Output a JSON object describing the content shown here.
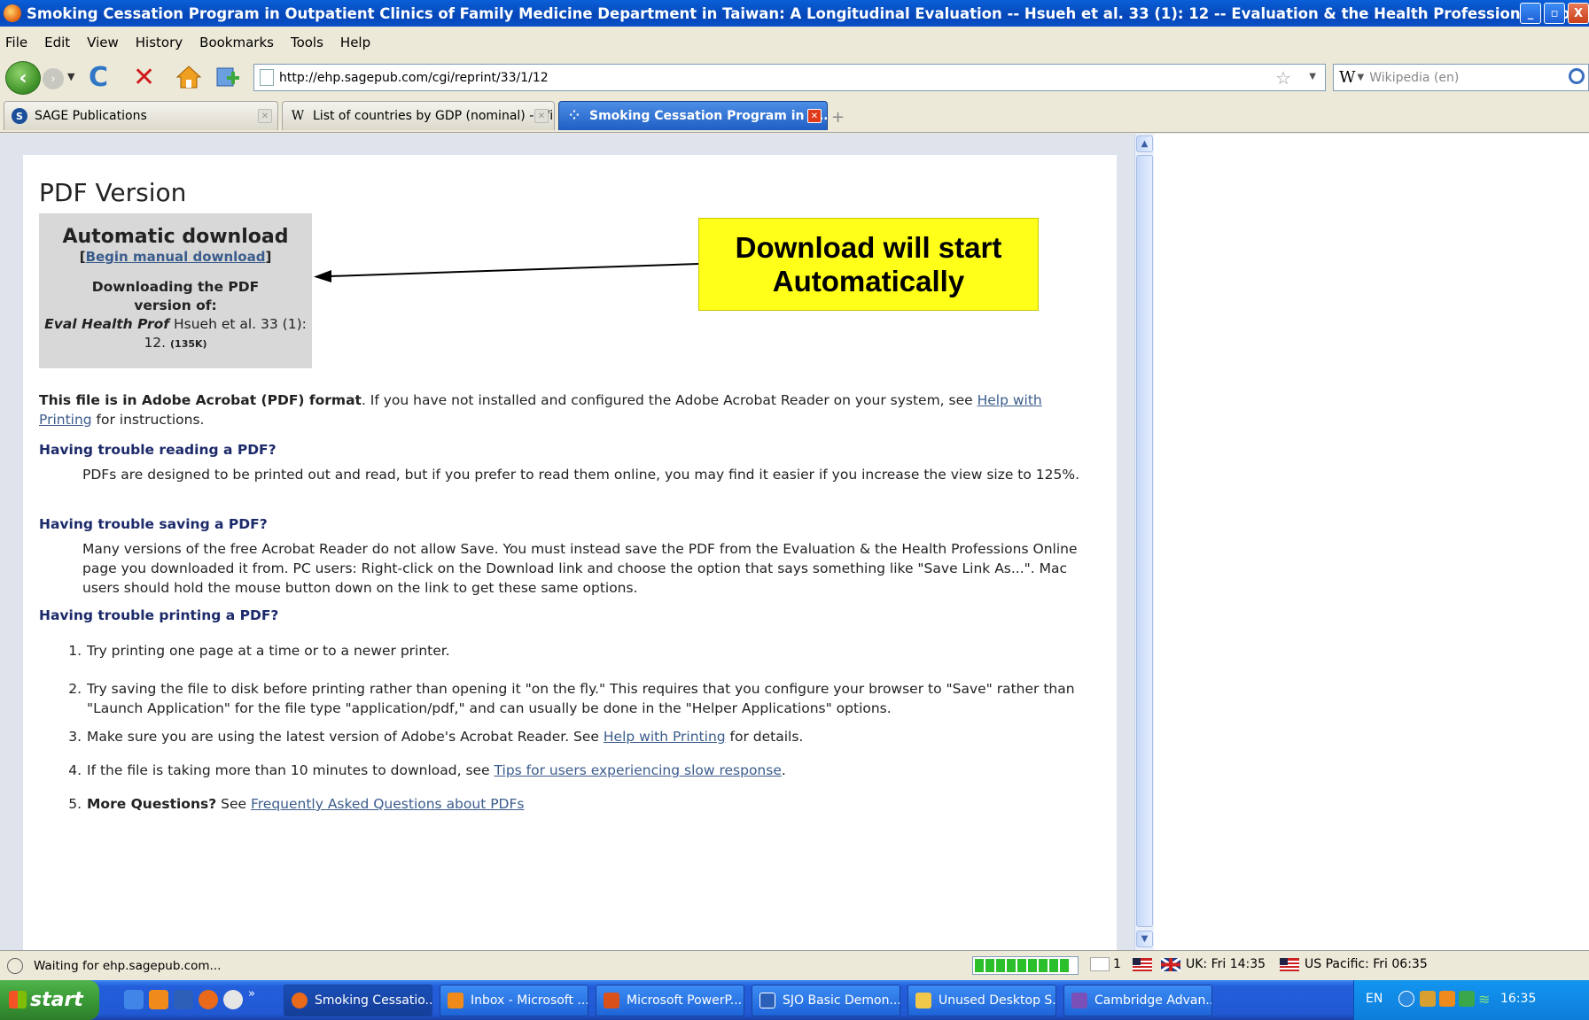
{
  "window": {
    "title": "Smoking Cessation Program in Outpatient Clinics of Family Medicine Department in Taiwan: A Longitudinal Evaluation -- Hsueh et al. 33 (1): 12 -- Evaluation & the Health Professions - Mozill...",
    "min": "_",
    "max": "▫",
    "close": "X"
  },
  "menu": [
    "File",
    "Edit",
    "View",
    "History",
    "Bookmarks",
    "Tools",
    "Help"
  ],
  "toolbar": {
    "url": "http://ehp.sagepub.com/cgi/reprint/33/1/12",
    "search_placeholder": "Wikipedia (en)",
    "search_engine": "W"
  },
  "tabs": [
    {
      "label": "SAGE Publications",
      "icon": "S",
      "active": false
    },
    {
      "label": "List of countries by GDP (nominal) - Wik...",
      "icon": "W",
      "active": false
    },
    {
      "label": "Smoking Cessation Program in O...",
      "icon": "⁘",
      "active": true
    }
  ],
  "page": {
    "heading": "PDF Version",
    "download_box": {
      "title": "Automatic download",
      "manual_prefix": "[",
      "manual_link": "Begin manual download",
      "manual_suffix": "]",
      "downloading": "Downloading the PDF version of:",
      "journal": "Eval Health Prof",
      "citation": " Hsueh et al. 33 (1): 12. ",
      "size": "(135K)"
    },
    "intro_bold": "This file is in Adobe Acrobat (PDF) format",
    "intro_text": ". If you have not installed and configured the Adobe Acrobat Reader on your system, see ",
    "intro_link": "Help with Printing",
    "intro_end": " for instructions.",
    "sections": [
      {
        "heading": "Having trouble reading a PDF?",
        "text": "PDFs are designed to be printed out and read, but if you prefer to read them online, you may find it easier if you increase the view size to 125%."
      },
      {
        "heading": "Having trouble saving a PDF?",
        "text": "Many versions of the free Acrobat Reader do not allow Save. You must instead save the PDF from the Evaluation & the Health Professions Online page you downloaded it from. PC users: Right-click on the Download link and choose the option that says something like \"Save Link As...\". Mac users should hold the mouse button down on the link to get these same options."
      },
      {
        "heading": "Having trouble printing a PDF?",
        "text": ""
      }
    ],
    "print_list": [
      {
        "num": "1.",
        "text": "Try printing one page at a time or to a newer printer."
      },
      {
        "num": "2.",
        "text": "Try saving the file to disk before printing rather than opening it \"on the fly.\" This requires that you configure your browser to \"Save\" rather than \"Launch Application\" for the file type \"application/pdf,\" and can usually be done in the \"Helper Applications\" options."
      },
      {
        "num": "3.",
        "pre": "Make sure you are using the latest version of Adobe's Acrobat Reader. See ",
        "link": "Help with Printing",
        "post": " for details."
      },
      {
        "num": "4.",
        "pre": "If the file is taking more than 10 minutes to download, see ",
        "link": "Tips for users experiencing slow response",
        "post": "."
      },
      {
        "num": "5.",
        "bold": "More Questions?",
        "pre": " See ",
        "link": "Frequently Asked Questions about PDFs",
        "post": ""
      }
    ]
  },
  "callout": {
    "line1": "Download will start",
    "line2": "Automatically",
    "bg": "#ffff1a"
  },
  "status": {
    "text": "Waiting for ehp.sagepub.com...",
    "mail_count": "1",
    "clock_uk": "UK: Fri 14:35",
    "clock_us": "US Pacific: Fri 06:35"
  },
  "taskbar": {
    "start": "start",
    "items": [
      "Smoking Cessatio...",
      "Inbox - Microsoft ...",
      "Microsoft PowerP...",
      "SJO Basic Demon...",
      "Unused Desktop S...",
      "Cambridge Advan..."
    ],
    "lang": "EN",
    "time": "16:35"
  }
}
